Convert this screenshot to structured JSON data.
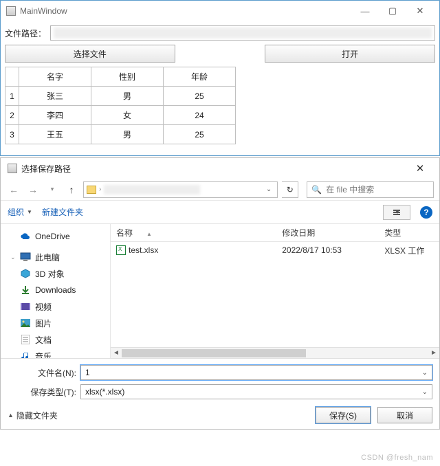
{
  "main": {
    "title": "MainWindow",
    "path_label": "文件路径：",
    "select_file_btn": "选择文件",
    "open_btn": "打开",
    "table": {
      "headers": [
        "名字",
        "性别",
        "年龄"
      ],
      "rows": [
        {
          "idx": "1",
          "cells": [
            "张三",
            "男",
            "25"
          ]
        },
        {
          "idx": "2",
          "cells": [
            "李四",
            "女",
            "24"
          ]
        },
        {
          "idx": "3",
          "cells": [
            "王五",
            "男",
            "25"
          ]
        }
      ]
    }
  },
  "dialog": {
    "title": "选择保存路径",
    "search_placeholder": "在 file 中搜索",
    "toolbar": {
      "organize": "组织",
      "newfolder": "新建文件夹"
    },
    "columns": {
      "name": "名称",
      "date": "修改日期",
      "type": "类型"
    },
    "files": [
      {
        "name": "test.xlsx",
        "date": "2022/8/17 10:53",
        "type": "XLSX 工作"
      }
    ],
    "tree": {
      "onedrive": "OneDrive",
      "thispc": "此电脑",
      "items": [
        "3D 对象",
        "Downloads",
        "视频",
        "图片",
        "文档",
        "音乐"
      ]
    },
    "filename_label": "文件名(N):",
    "filename_value": "1",
    "filetype_label": "保存类型(T):",
    "filetype_value": "xlsx(*.xlsx)",
    "hide_folders": "隐藏文件夹",
    "save_btn": "保存(S)",
    "cancel_btn": "取消"
  },
  "watermark": "CSDN @fresh_nam"
}
